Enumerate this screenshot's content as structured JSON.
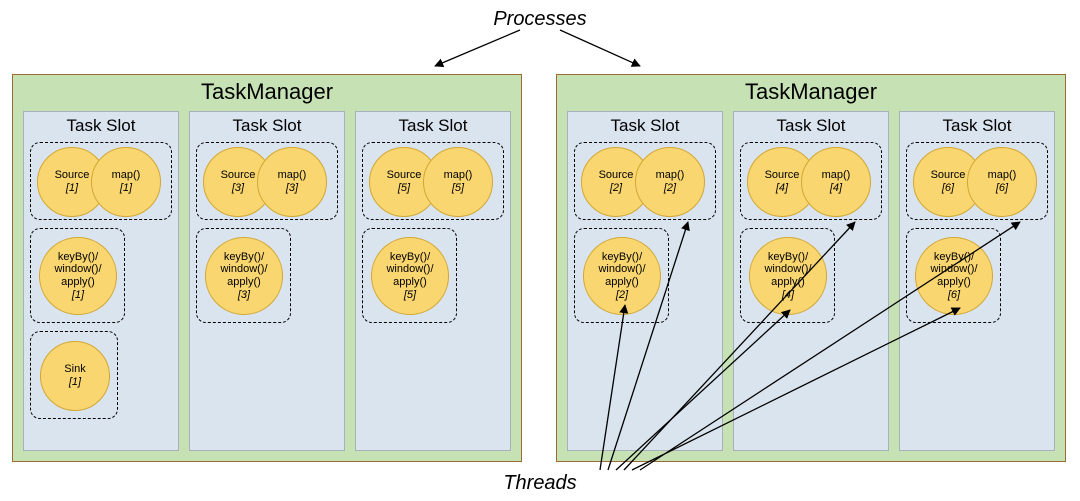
{
  "labels": {
    "processes": "Processes",
    "threads": "Threads",
    "taskManager": "TaskManager",
    "taskSlot": "Task Slot",
    "source": "Source",
    "map": "map()",
    "keyByWindowApply": "keyBy()/\nwindow()/\napply()",
    "sink": "Sink"
  },
  "taskManagers": [
    {
      "slots": [
        {
          "sourceIdx": "[1]",
          "mapIdx": "[1]",
          "keyIdx": "[1]",
          "sink": "[1]"
        },
        {
          "sourceIdx": "[3]",
          "mapIdx": "[3]",
          "keyIdx": "[3]",
          "sink": null
        },
        {
          "sourceIdx": "[5]",
          "mapIdx": "[5]",
          "keyIdx": "[5]",
          "sink": null
        }
      ]
    },
    {
      "slots": [
        {
          "sourceIdx": "[2]",
          "mapIdx": "[2]",
          "keyIdx": "[2]",
          "sink": null
        },
        {
          "sourceIdx": "[4]",
          "mapIdx": "[4]",
          "keyIdx": "[4]",
          "sink": null
        },
        {
          "sourceIdx": "[6]",
          "mapIdx": "[6]",
          "keyIdx": "[6]",
          "sink": null
        }
      ]
    }
  ],
  "chart_data": {
    "type": "diagram",
    "title": "Flink TaskManager slot and thread layout",
    "nodes": {
      "Processes": [
        "TaskManager-1",
        "TaskManager-2"
      ],
      "TaskManager-1": {
        "label": "TaskManager",
        "slots": [
          {
            "label": "Task Slot",
            "threads": [
              [
                "Source [1]",
                "map() [1]"
              ],
              [
                "keyBy()/window()/apply() [1]"
              ],
              [
                "Sink [1]"
              ]
            ]
          },
          {
            "label": "Task Slot",
            "threads": [
              [
                "Source [3]",
                "map() [3]"
              ],
              [
                "keyBy()/window()/apply() [3]"
              ]
            ]
          },
          {
            "label": "Task Slot",
            "threads": [
              [
                "Source [5]",
                "map() [5]"
              ],
              [
                "keyBy()/window()/apply() [5]"
              ]
            ]
          }
        ]
      },
      "TaskManager-2": {
        "label": "TaskManager",
        "slots": [
          {
            "label": "Task Slot",
            "threads": [
              [
                "Source [2]",
                "map() [2]"
              ],
              [
                "keyBy()/window()/apply() [2]"
              ]
            ]
          },
          {
            "label": "Task Slot",
            "threads": [
              [
                "Source [4]",
                "map() [4]"
              ],
              [
                "keyBy()/window()/apply() [4]"
              ]
            ]
          },
          {
            "label": "Task Slot",
            "threads": [
              [
                "Source [6]",
                "map() [6]"
              ],
              [
                "keyBy()/window()/apply() [6]"
              ]
            ]
          }
        ]
      }
    },
    "arrow_groups": [
      {
        "label": "Processes",
        "targets": [
          "TaskManager-1",
          "TaskManager-2"
        ]
      },
      {
        "label": "Threads",
        "targets": [
          "TaskManager-2 slot bubbles"
        ]
      }
    ]
  }
}
